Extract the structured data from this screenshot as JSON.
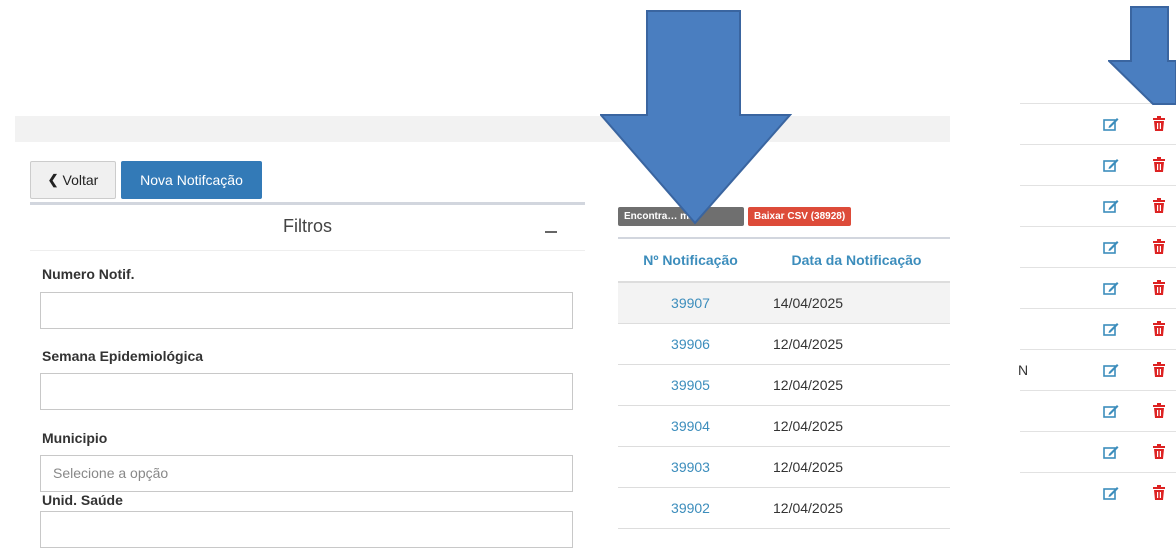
{
  "toolbar": {
    "back_label": "Voltar",
    "new_label": "Nova Notifcação"
  },
  "filters": {
    "title": "Filtros",
    "fields": {
      "numero": {
        "label": "Numero Notif.",
        "value": ""
      },
      "semana": {
        "label": "Semana Epidemiológica",
        "value": ""
      },
      "municipio": {
        "label": "Municipio",
        "placeholder": "Selecione a opção"
      },
      "unid": {
        "label": "Unid. Saúde"
      }
    }
  },
  "results": {
    "found_badge": "Encontra… mil",
    "csv_badge": "Baixar CSV (38928)"
  },
  "table": {
    "headers": [
      "Nº Notificação",
      "Data da Notificação"
    ],
    "rows": [
      {
        "id": "39907",
        "date": "14/04/2025"
      },
      {
        "id": "39906",
        "date": "12/04/2025"
      },
      {
        "id": "39905",
        "date": "12/04/2025"
      },
      {
        "id": "39904",
        "date": "12/04/2025"
      },
      {
        "id": "39903",
        "date": "12/04/2025"
      },
      {
        "id": "39902",
        "date": "12/04/2025"
      }
    ]
  },
  "actions": {
    "rows": [
      {
        "text": ""
      },
      {
        "text": ""
      },
      {
        "text": ""
      },
      {
        "text": ""
      },
      {
        "text": ""
      },
      {
        "text": ""
      },
      {
        "text": "N"
      },
      {
        "text": ""
      },
      {
        "text": ""
      },
      {
        "text": ""
      }
    ],
    "edit_icon": "edit-icon",
    "delete_icon": "trash-icon",
    "edit_color": "#3c8dbc",
    "delete_color": "#dd2222"
  },
  "annotation_color": "#4a7ec0"
}
